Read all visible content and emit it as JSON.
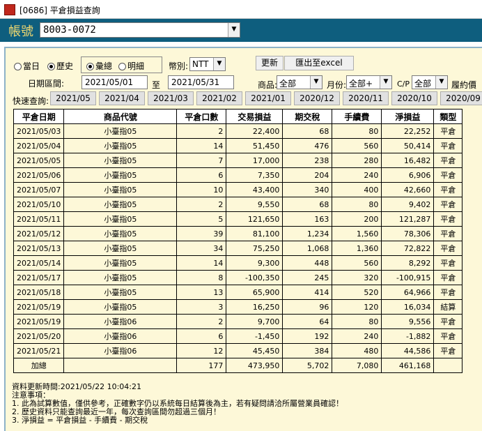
{
  "window": {
    "title": "[0686] 平倉損益查詢"
  },
  "header": {
    "account_label": "帳號",
    "account_value": "8003-0072"
  },
  "filters": {
    "radio_today": "當日",
    "radio_history": "歷史",
    "radio_summary": "彙總",
    "radio_detail": "明細",
    "currency_label": "幣別:",
    "currency_value": "NTT",
    "refresh_label": "更新",
    "export_label": "匯出至excel",
    "date_range_label": "日期區間:",
    "date_from": "2021/05/01",
    "date_to_label": "至",
    "date_to": "2021/05/31",
    "product_label": "商品:",
    "product_value": "全部",
    "month_label": "月份:",
    "month_value": "全部+",
    "cp_label": "C/P",
    "cp_value": "全部",
    "expiry_label": "履約價"
  },
  "quick": {
    "label": "快速查詢:",
    "buttons": [
      "2021/05",
      "2021/04",
      "2021/03",
      "2021/02",
      "2021/01",
      "2020/12",
      "2020/11",
      "2020/10",
      "2020/09"
    ]
  },
  "table": {
    "headers": [
      "平倉日期",
      "商品代號",
      "平倉口數",
      "交易損益",
      "期交稅",
      "手續費",
      "淨損益",
      "類型"
    ],
    "rows": [
      [
        "2021/05/03",
        "小臺指05",
        "2",
        "22,400",
        "68",
        "80",
        "22,252",
        "平倉"
      ],
      [
        "2021/05/04",
        "小臺指05",
        "14",
        "51,450",
        "476",
        "560",
        "50,414",
        "平倉"
      ],
      [
        "2021/05/05",
        "小臺指05",
        "7",
        "17,000",
        "238",
        "280",
        "16,482",
        "平倉"
      ],
      [
        "2021/05/06",
        "小臺指05",
        "6",
        "7,350",
        "204",
        "240",
        "6,906",
        "平倉"
      ],
      [
        "2021/05/07",
        "小臺指05",
        "10",
        "43,400",
        "340",
        "400",
        "42,660",
        "平倉"
      ],
      [
        "2021/05/10",
        "小臺指05",
        "2",
        "9,550",
        "68",
        "80",
        "9,402",
        "平倉"
      ],
      [
        "2021/05/11",
        "小臺指05",
        "5",
        "121,650",
        "163",
        "200",
        "121,287",
        "平倉"
      ],
      [
        "2021/05/12",
        "小臺指05",
        "39",
        "81,100",
        "1,234",
        "1,560",
        "78,306",
        "平倉"
      ],
      [
        "2021/05/13",
        "小臺指05",
        "34",
        "75,250",
        "1,068",
        "1,360",
        "72,822",
        "平倉"
      ],
      [
        "2021/05/14",
        "小臺指05",
        "14",
        "9,300",
        "448",
        "560",
        "8,292",
        "平倉"
      ],
      [
        "2021/05/17",
        "小臺指05",
        "8",
        "-100,350",
        "245",
        "320",
        "-100,915",
        "平倉"
      ],
      [
        "2021/05/18",
        "小臺指05",
        "13",
        "65,900",
        "414",
        "520",
        "64,966",
        "平倉"
      ],
      [
        "2021/05/19",
        "小臺指05",
        "3",
        "16,250",
        "96",
        "120",
        "16,034",
        "結算"
      ],
      [
        "2021/05/19",
        "小臺指06",
        "2",
        "9,700",
        "64",
        "80",
        "9,556",
        "平倉"
      ],
      [
        "2021/05/20",
        "小臺指06",
        "6",
        "-1,450",
        "192",
        "240",
        "-1,882",
        "平倉"
      ],
      [
        "2021/05/21",
        "小臺指06",
        "12",
        "45,450",
        "384",
        "480",
        "44,586",
        "平倉"
      ]
    ],
    "total": [
      "加總",
      "",
      "177",
      "473,950",
      "5,702",
      "7,080",
      "461,168",
      ""
    ]
  },
  "footer": {
    "updated": "資料更新時間:2021/05/22 10:04:21",
    "notes": [
      " 注意事項：",
      "1. 此為試算數值，僅供參考，正確數字仍以系統每日結算後為主，若有疑問請洽所屬營業員確認！",
      "2. 歷史資料只能查詢最近一年，每次查詢區間勿超過三個月！",
      "3. 淨損益 = 平倉損益 - 手續費 - 期交稅"
    ]
  }
}
